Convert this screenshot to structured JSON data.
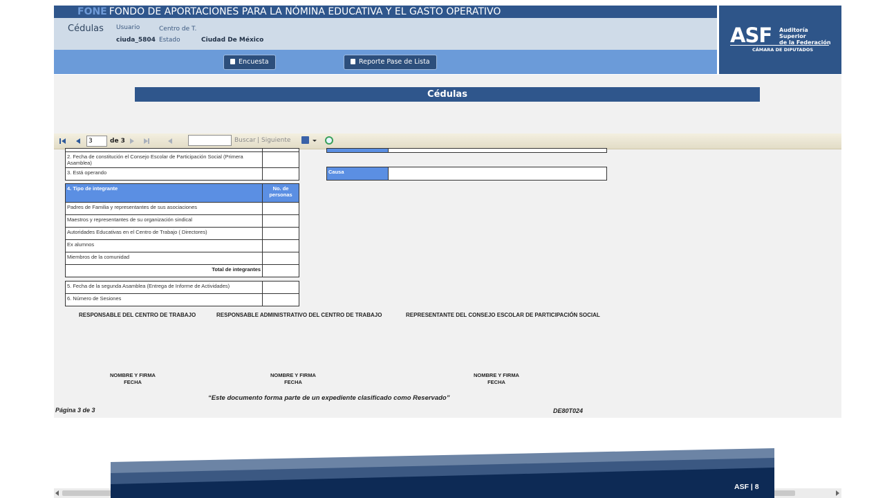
{
  "header": {
    "abbr": "FONE",
    "title": "FONDO DE APORTACIONES PARA LA NÓMINA EDUCATIVA Y EL GASTO OPERATIVO",
    "section": "Cédulas",
    "usuario_label": "Usuario",
    "usuario_value": "ciuda_5804",
    "centro_label": "Centro de T.",
    "estado_label": "Estado",
    "estado_value": "Ciudad De México"
  },
  "buttons": {
    "encuesta": "Encuesta",
    "reporte": "Reporte Pase de Lista"
  },
  "logo": {
    "mark": "ASF",
    "line1": "Auditoría",
    "line2": "Superior",
    "line3": "de la Federación",
    "camara": "CÁMARA DE DIPUTADOS"
  },
  "page_heading": "Cédulas",
  "toolbar": {
    "page_value": "3",
    "of_label": "de 3",
    "buscar": "Buscar",
    "sep": "|",
    "siguiente": "Siguiente"
  },
  "report": {
    "top_rows": [
      "2. Fecha de constitución el Consejo Escolar de Participación Social (Primera Asamblea)",
      "3. Está operando"
    ],
    "causa_label": "Causa",
    "integrantes_header": "4. Tipo de integrante",
    "personas_header": "No. de personas",
    "integrantes": [
      "Padres de Familia y representantes de sus asociaciones",
      "Maestros y representantes de su organización sindical",
      "Autoridades Educativas en el Centro de Trabajo ( Directores)",
      "Ex alumnos",
      "Miembros de la comunidad"
    ],
    "total_label": "Total de integrantes",
    "bottom_rows": [
      "5. Fecha de la segunda Asamblea (Entrega de Informe de Actividades)",
      "6. Número de Sesiones"
    ],
    "signatures": [
      "RESPONSABLE DEL CENTRO DE TRABAJO",
      "RESPONSABLE ADMINISTRATIVO DEL CENTRO DE TRABAJO",
      "REPRESENTANTE DEL CONSEJO ESCOLAR DE PARTICIPACIÓN SOCIAL"
    ],
    "nombre_firma": "NOMBRE Y FIRMA",
    "fecha": "FECHA",
    "note": "“Este documento forma parte de un expediente clasificado como Reservado”",
    "page_footer": "Página 3 de 3",
    "code": "DE80T024"
  },
  "slide_footer": "ASF | 8",
  "colors": {
    "primary": "#2f568c",
    "button_bar": "#6b9bd9",
    "info_bar": "#cfdbe8",
    "table_header": "#5b8fe3",
    "footer_dark": "#0d2a55"
  }
}
